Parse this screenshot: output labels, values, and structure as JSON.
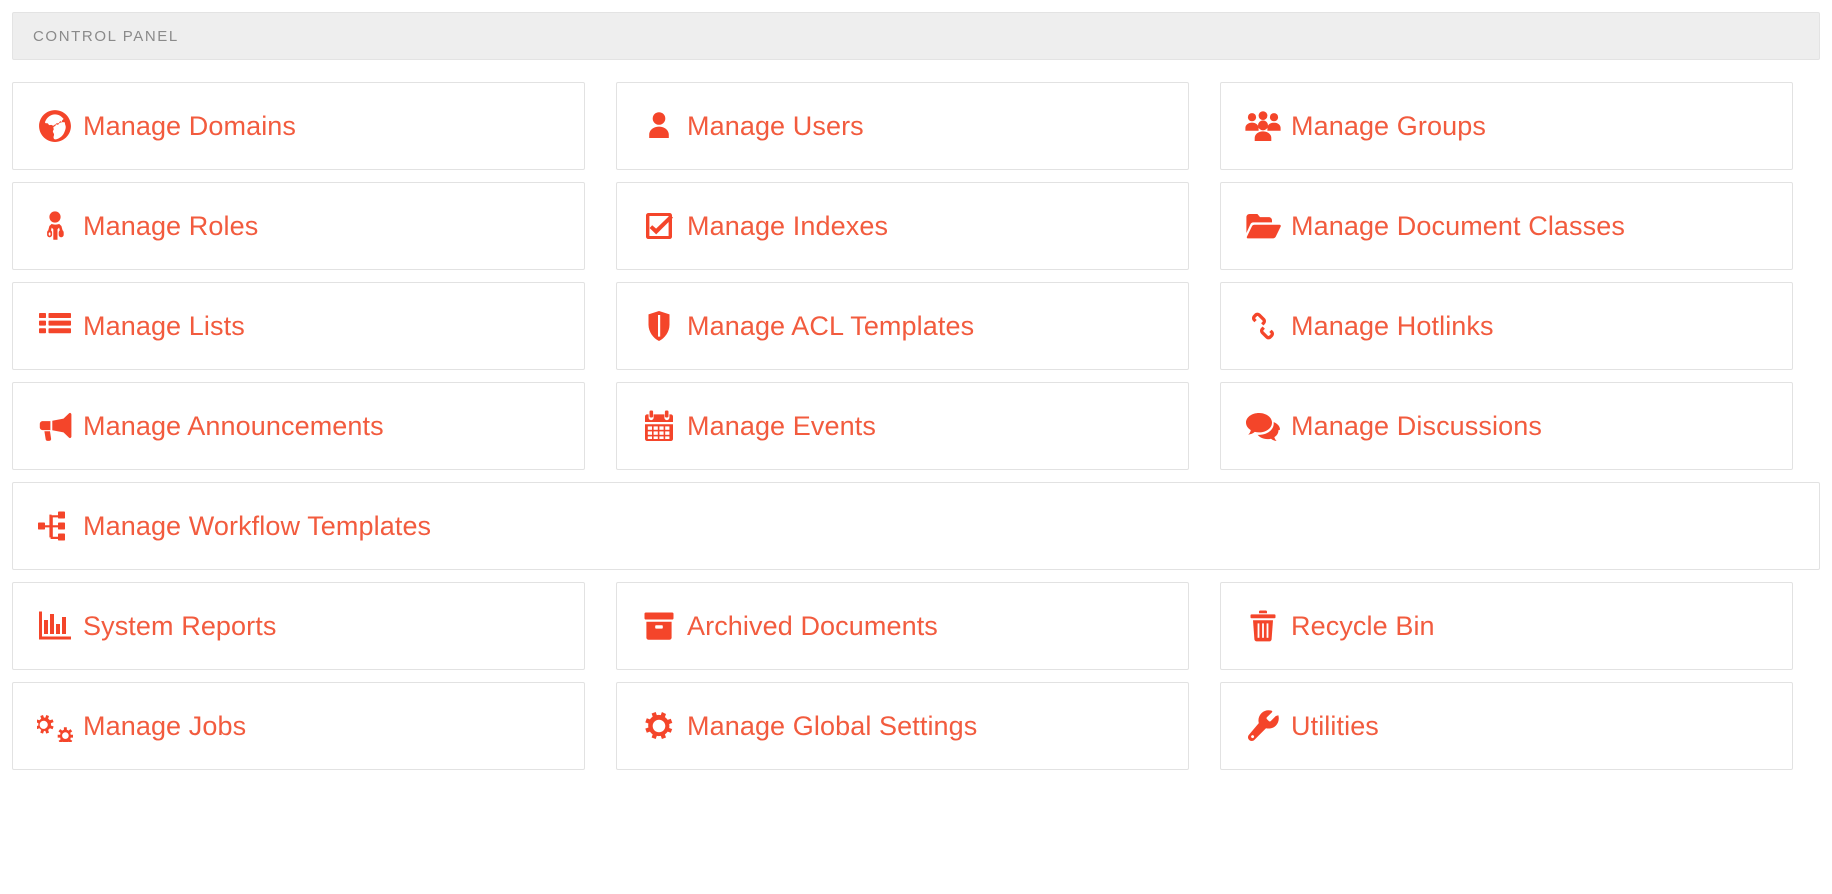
{
  "header": {
    "title": "CONTROL PANEL"
  },
  "theme": {
    "accent": "#f4452a",
    "label_color": "#f25b3e",
    "header_bg": "#eeeeee",
    "header_text": "#8a8a8a",
    "card_bg": "#ffffff",
    "card_border": "#e2e2e2",
    "page_bg": "#ffffff"
  },
  "cards": [
    {
      "label": "Manage Domains",
      "icon": "globe-icon",
      "name": "manage-domains",
      "full": false
    },
    {
      "label": "Manage Users",
      "icon": "user-icon",
      "name": "manage-users",
      "full": false
    },
    {
      "label": "Manage Groups",
      "icon": "users-group-icon",
      "name": "manage-groups",
      "full": false
    },
    {
      "label": "Manage Roles",
      "icon": "user-md-icon",
      "name": "manage-roles",
      "full": false
    },
    {
      "label": "Manage Indexes",
      "icon": "check-square-icon",
      "name": "manage-indexes",
      "full": false
    },
    {
      "label": "Manage Document Classes",
      "icon": "folder-open-icon",
      "name": "manage-document-classes",
      "full": false
    },
    {
      "label": "Manage Lists",
      "icon": "th-list-icon",
      "name": "manage-lists",
      "full": false
    },
    {
      "label": "Manage ACL Templates",
      "icon": "shield-icon",
      "name": "manage-acl-templates",
      "full": false
    },
    {
      "label": "Manage Hotlinks",
      "icon": "chain-link-icon",
      "name": "manage-hotlinks",
      "full": false
    },
    {
      "label": "Manage Announcements",
      "icon": "bullhorn-icon",
      "name": "manage-announcements",
      "full": false
    },
    {
      "label": "Manage Events",
      "icon": "calendar-icon",
      "name": "manage-events",
      "full": false
    },
    {
      "label": "Manage Discussions",
      "icon": "comments-icon",
      "name": "manage-discussions",
      "full": false
    },
    {
      "label": "Manage Workflow Templates",
      "icon": "sitemap-icon",
      "name": "manage-workflow-templates",
      "full": true
    },
    {
      "label": "System Reports",
      "icon": "bar-chart-icon",
      "name": "system-reports",
      "full": false
    },
    {
      "label": "Archived Documents",
      "icon": "archive-icon",
      "name": "archived-documents",
      "full": false
    },
    {
      "label": "Recycle Bin",
      "icon": "trash-icon",
      "name": "recycle-bin",
      "full": false
    },
    {
      "label": "Manage Jobs",
      "icon": "cogs-icon",
      "name": "manage-jobs",
      "full": false
    },
    {
      "label": "Manage Global Settings",
      "icon": "cog-icon",
      "name": "manage-global-settings",
      "full": false
    },
    {
      "label": "Utilities",
      "icon": "wrench-icon",
      "name": "utilities",
      "full": false
    }
  ]
}
